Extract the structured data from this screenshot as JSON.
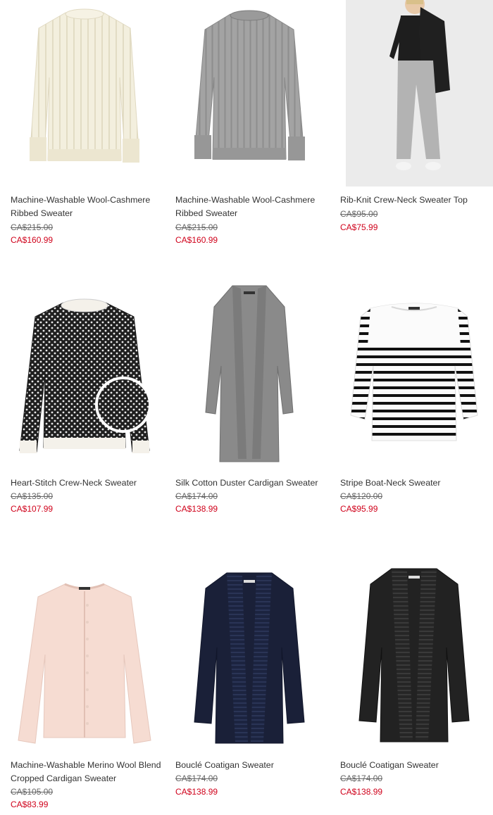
{
  "products": [
    {
      "name": "Machine-Washable Wool-Cashmere Ribbed Sweater",
      "original_price": "CA$215.00",
      "sale_price": "CA$160.99",
      "image": "cream-ribbed-sweater"
    },
    {
      "name": "Machine-Washable Wool-Cashmere Ribbed Sweater",
      "original_price": "CA$215.00",
      "sale_price": "CA$160.99",
      "image": "grey-ribbed-sweater"
    },
    {
      "name": "Rib-Knit Crew-Neck Sweater Top",
      "original_price": "CA$95.00",
      "sale_price": "CA$75.99",
      "image": "model-black-top-grey-pants"
    },
    {
      "name": "Heart-Stitch Crew-Neck Sweater",
      "original_price": "CA$135.00",
      "sale_price": "CA$107.99",
      "image": "black-white-heart-stitch-sweater"
    },
    {
      "name": "Silk Cotton Duster Cardigan Sweater",
      "original_price": "CA$174.00",
      "sale_price": "CA$138.99",
      "image": "grey-duster-cardigan"
    },
    {
      "name": "Stripe Boat-Neck Sweater",
      "original_price": "CA$120.00",
      "sale_price": "CA$95.99",
      "image": "striped-boat-neck-sweater"
    },
    {
      "name": "Machine-Washable Merino Wool Blend Cropped Cardigan Sweater",
      "original_price": "CA$105.00",
      "sale_price": "CA$83.99",
      "image": "pink-cropped-cardigan"
    },
    {
      "name": "Bouclé Coatigan Sweater",
      "original_price": "CA$174.00",
      "sale_price": "CA$138.99",
      "image": "navy-boucle-coatigan"
    },
    {
      "name": "Bouclé Coatigan Sweater",
      "original_price": "CA$174.00",
      "sale_price": "CA$138.99",
      "image": "charcoal-boucle-coatigan"
    }
  ],
  "colors": {
    "sale": "#d0021b",
    "text": "#333333",
    "strike": "#666666"
  }
}
